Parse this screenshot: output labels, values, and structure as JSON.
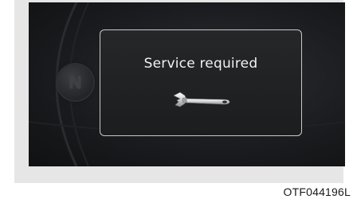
{
  "display": {
    "gear_indicator": "N",
    "message": "Service required",
    "icon": "wrench-icon"
  },
  "figure_code": "OTF044196L"
}
